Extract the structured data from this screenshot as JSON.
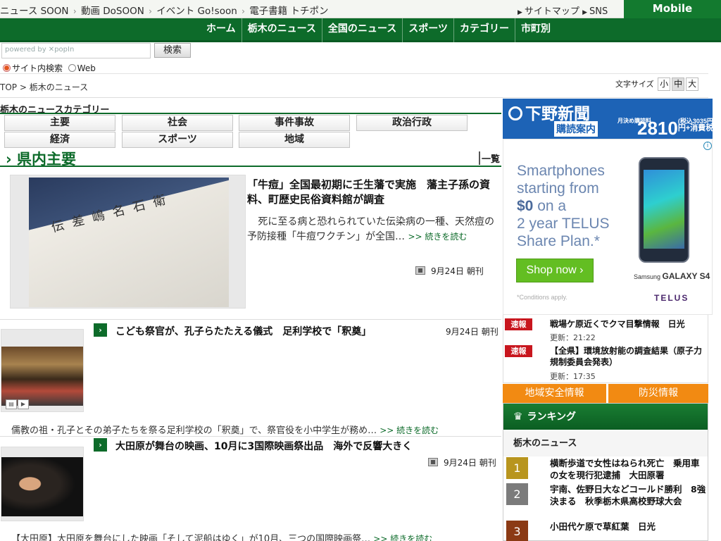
{
  "topbar": {
    "links": [
      "ニュース SOON",
      "動画 DoSOON",
      "イベント Go!soon",
      "電子書籍 トチポン"
    ],
    "sitemap": "サイトマップ",
    "sns": "SNS",
    "mobile": "Mobile"
  },
  "nav": [
    "ホーム",
    "栃木のニュース",
    "全国のニュース",
    "スポーツ",
    "カテゴリー",
    "市町別"
  ],
  "search": {
    "placeholder": "powered by ✕popIn",
    "button": "検索",
    "opt_site": "サイト内検索",
    "opt_web": "Web"
  },
  "breadcrumb": "TOP > 栃木のニュース",
  "fontsize": {
    "label": "文字サイズ",
    "small": "小",
    "medium": "中",
    "large": "大"
  },
  "category": {
    "title": "栃木のニュースカテゴリー",
    "items": [
      "主要",
      "社会",
      "事件事故",
      "政治行政",
      "経済",
      "スポーツ",
      "地域"
    ]
  },
  "section": {
    "title": "› 県内主要",
    "more": "一覧"
  },
  "feature": {
    "headline": "「牛痘」全国最初期に壬生藩で実施　藩主子孫の資料、町歴史民俗資料館が調査",
    "lead": "死に至る病と恐れられていた伝染病の一種、天然痘の予防接種「牛痘ワクチン」が全国…",
    "more": ">> 続きを読む",
    "date": "9月24日 朝刊",
    "image_text": "伝 差 嶋 名 石 衛"
  },
  "articles": [
    {
      "headline": "こども祭官が、孔子らたたえる儀式　足利学校で「釈奠」",
      "date": "9月24日 朝刊",
      "snippet": "儒教の祖・孔子とその弟子たちを祭る足利学校の「釈奠」で、祭官役を小中学生が務め…",
      "more": ">> 続きを読む"
    },
    {
      "headline": "大田原が舞台の映画、10月に3国際映画祭出品　海外で反響大きく",
      "date": "9月24日 朝刊",
      "snippet": "【大田原】大田原を舞台にした映画「そして泥船はゆく」が10月、三つの国際映画祭…",
      "more": ">> 続きを読む"
    }
  ],
  "ad_shimotsuke": {
    "logo": "下野新聞",
    "sub": "購読案内",
    "monthly": "月決め購読料",
    "price": "2810",
    "tax_note": "(税込3035円)",
    "price_suffix": "円+消費税"
  },
  "ad_telus": {
    "line1": "Smartphones",
    "line2": "starting from",
    "price": "$0",
    "line3": " on a",
    "line4": "2 year TELUS",
    "line5": "Share Plan.*",
    "shop": "Shop now  ›",
    "conditions": "*Conditions apply.",
    "galaxy": "Samsung",
    "galaxy_model": "GALAXY S4",
    "telus": "TELUS"
  },
  "alerts": [
    {
      "tag": "速報",
      "title": "戦場ケ原近くでクマ目撃情報　日光",
      "updated": "更新：21:22"
    },
    {
      "tag": "速報",
      "title": "【全県】環境放射能の調査結果（原子力規制委員会発表）",
      "updated": "更新：17:35"
    }
  ],
  "safety": {
    "left": "地域安全情報",
    "right": "防災情報"
  },
  "ranking": {
    "title": "ランキング",
    "subtitle": "栃木のニュース",
    "items": [
      {
        "num": "1",
        "text": "横断歩道で女性はねられ死亡　乗用車の女を現行犯逮捕　大田原署",
        "color": "#b8951e"
      },
      {
        "num": "2",
        "text": "宇南、佐野日大などコールド勝利　8強決まる　秋季栃木県高校野球大会",
        "color": "#7b7b7b"
      },
      {
        "num": "3",
        "text": "小田代ケ原で草紅葉　日光",
        "color": "#8b3a14"
      }
    ]
  }
}
